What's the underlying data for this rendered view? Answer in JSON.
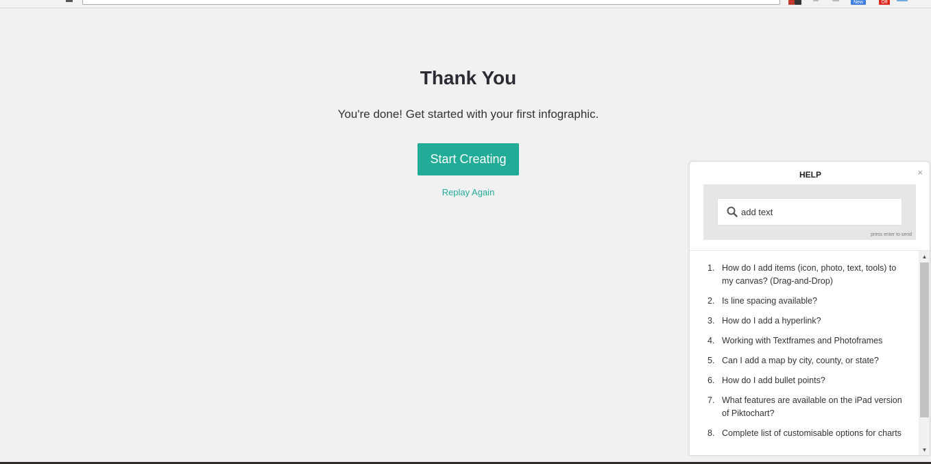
{
  "browser": {
    "extensions": {
      "new_badge": "New",
      "off_badge": "Off"
    }
  },
  "main": {
    "title": "Thank You",
    "subtitle": "You're done! Get started with your first infographic.",
    "start_button": "Start Creating",
    "replay_link": "Replay Again"
  },
  "help": {
    "title": "HELP",
    "close": "×",
    "search": {
      "value": "add text",
      "hint": "press enter to send"
    },
    "items": [
      {
        "num": "1.",
        "text": "How do I add items (icon, photo, text, tools) to my canvas? (Drag-and-Drop)"
      },
      {
        "num": "2.",
        "text": "Is line spacing available?"
      },
      {
        "num": "3.",
        "text": "How do I add a hyperlink?"
      },
      {
        "num": "4.",
        "text": "Working with Textframes and Photoframes"
      },
      {
        "num": "5.",
        "text": "Can I add a map by city, county, or state?"
      },
      {
        "num": "6.",
        "text": "How do I add bullet points?"
      },
      {
        "num": "7.",
        "text": "What features are available on the iPad version of Piktochart?"
      },
      {
        "num": "8.",
        "text": "Complete list of customisable options for charts"
      }
    ]
  },
  "colors": {
    "accent": "#21ac97",
    "background": "#f1f1f1"
  }
}
